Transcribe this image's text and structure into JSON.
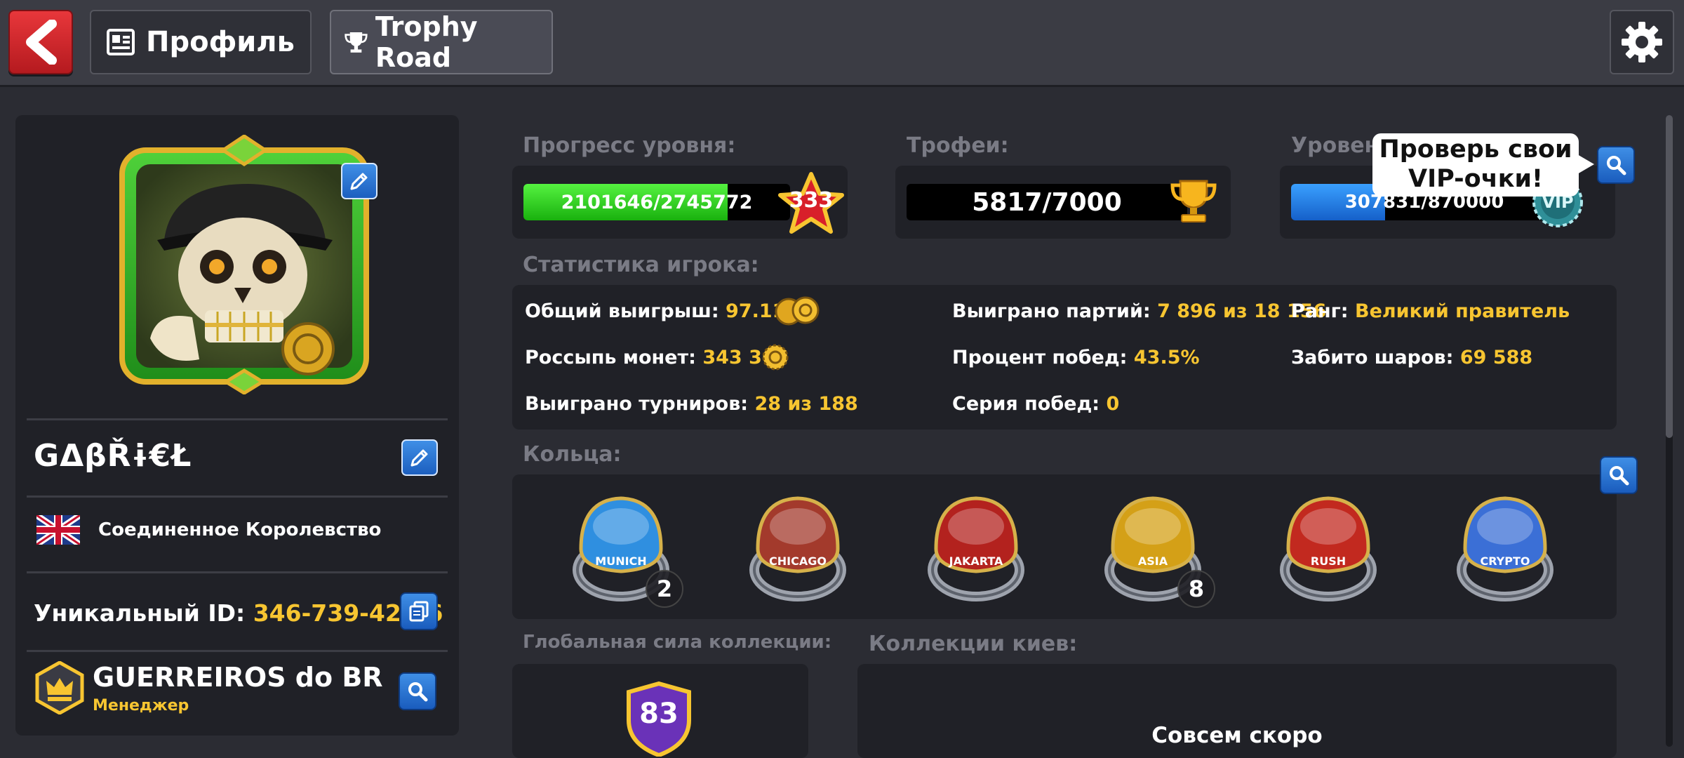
{
  "header": {
    "tabs": [
      {
        "label": "Профиль",
        "icon": "profile-card-icon",
        "active": false
      },
      {
        "label": "Trophy Road",
        "icon": "trophy-icon",
        "active": true
      }
    ]
  },
  "profile": {
    "name": "GΔβŘɨ€Ł",
    "country": "Соединенное Королевство",
    "uid_label": "Уникальный ID:",
    "uid_value": "346-739-423-6",
    "club_name": "GUERREIROS do BR",
    "club_role": "Менеджер"
  },
  "level": {
    "label": "Прогресс уровня:",
    "progress_text": "2101646/2745772",
    "current": 2101646,
    "max": 2745772,
    "level_number": "333"
  },
  "trophies": {
    "label": "Трофеи:",
    "value": "5817/7000"
  },
  "vip": {
    "label": "Уровень",
    "progress_text": "307831/870000",
    "current": 307831,
    "max": 870000,
    "badge": "VIP",
    "tooltip_line1": "Проверь свои",
    "tooltip_line2": "VIP-очки!"
  },
  "stats": {
    "label": "Статистика игрока:",
    "total_winnings_label": "Общий выигрыш:",
    "total_winnings_value": "97.11B",
    "coin_spill_label": "Россыпь монет:",
    "coin_spill_value": "343 366",
    "tournaments_label": "Выиграно турниров:",
    "tournaments_value": "28 из 188",
    "games_won_label": "Выиграно партий:",
    "games_won_value": "7 896 из 18 156",
    "win_rate_label": "Процент побед:",
    "win_rate_value": "43.5%",
    "streak_label": "Серия побед:",
    "streak_value": "0",
    "rank_label": "Ранг:",
    "rank_value": "Великий правитель",
    "balls_potted_label": "Забито шаров:",
    "balls_potted_value": "69 588"
  },
  "rings": {
    "label": "Кольца:",
    "items": [
      {
        "text": "MUNICH",
        "count": "2",
        "color": "#2f8fe0"
      },
      {
        "text": "CHICAGO",
        "count": "",
        "color": "#a33a2c"
      },
      {
        "text": "JAKARTA",
        "count": "",
        "color": "#b3221e"
      },
      {
        "text": "ASIA",
        "count": "8",
        "color": "#d4a017"
      },
      {
        "text": "RUSH",
        "count": "",
        "color": "#c2291f"
      },
      {
        "text": "CRYPTO",
        "count": "",
        "color": "#3b6fd6"
      }
    ]
  },
  "collection": {
    "power_label": "Глобальная сила коллекции:",
    "power_value": "83",
    "cues_label": "Коллекции киев:",
    "cues_status": "Совсем скоро"
  },
  "colors": {
    "level_bar": "#28d11c",
    "vip_bar": "#1f7fe6",
    "accent_yellow": "#f7c531",
    "back_red": "#d62a2f"
  }
}
